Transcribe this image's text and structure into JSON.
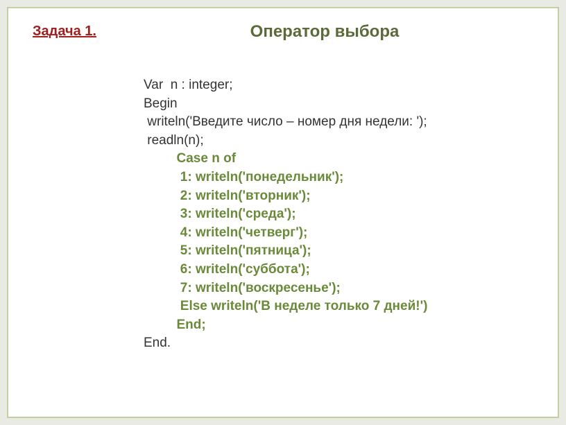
{
  "task_label": "Задача 1.",
  "title": "Оператор выбора",
  "code": {
    "line1": "Var  n : integer;",
    "line2": "Begin",
    "line3": " writeln('Введите число – номер дня недели: ');",
    "line4": " readln(n);",
    "line5": "         Case n of",
    "line6": "          1: writeln('понедельник');",
    "line7": "          2: writeln('вторник');",
    "line8": "          3: writeln('среда');",
    "line9": "          4: writeln('четверг');",
    "line10": "          5: writeln('пятница');",
    "line11": "          6: writeln('суббота');",
    "line12": "          7: writeln('воскресенье');",
    "line13": "          Else writeln('В неделе только 7 дней!')",
    "line14": "         End;",
    "line15": "",
    "line16": "End."
  }
}
